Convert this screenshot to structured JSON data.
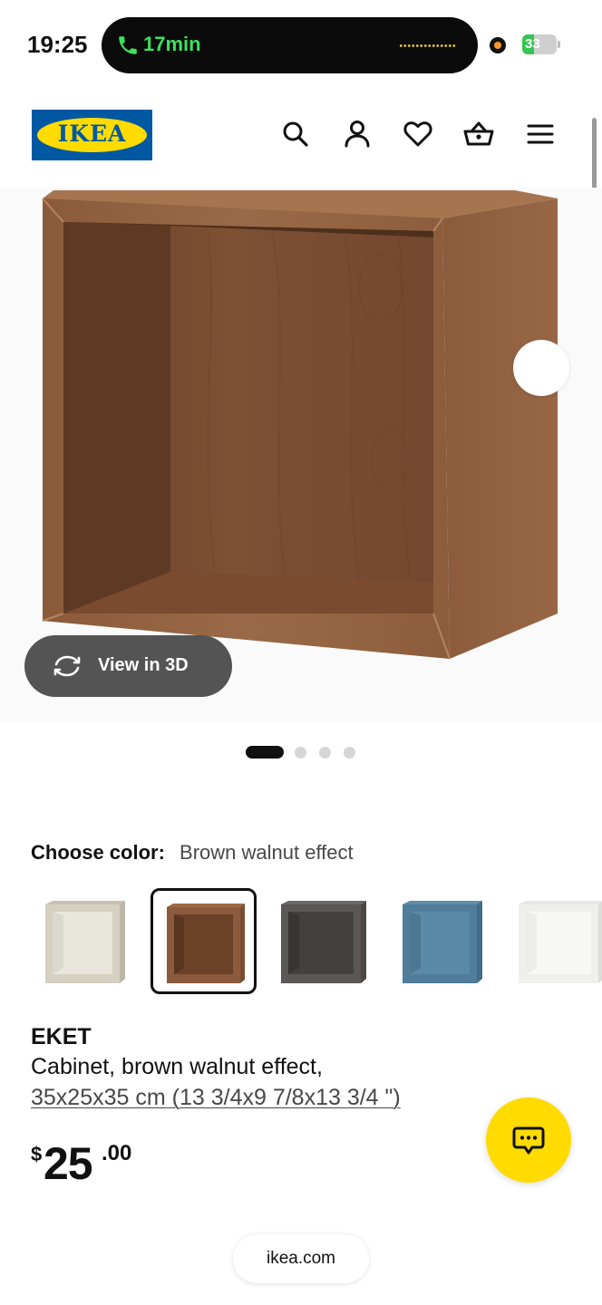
{
  "status_bar": {
    "time": "19:25",
    "call_duration": "17min",
    "battery_level": "33",
    "battery_fraction": 0.33
  },
  "header": {
    "logo_text": "IKEA",
    "icons": [
      "search-icon",
      "account-icon",
      "heart-icon",
      "basket-icon",
      "menu-icon"
    ]
  },
  "gallery": {
    "view_3d_label": "View in 3D",
    "image_count": 4,
    "active_index": 0
  },
  "color_chooser": {
    "label": "Choose color:",
    "selected_value": "Brown walnut effect",
    "swatches": [
      {
        "name": "beige",
        "front": "#d2ccbd",
        "side": "#bdb6a6",
        "inner": "#e8e5dd"
      },
      {
        "name": "brown walnut effect",
        "front": "#8c5a3c",
        "side": "#7a4d32",
        "inner": "#6b4128",
        "selected": true
      },
      {
        "name": "dark gray",
        "front": "#5a5756",
        "side": "#4a4746",
        "inner": "#3f3d3c"
      },
      {
        "name": "blue",
        "front": "#4f7d9a",
        "side": "#426c87",
        "inner": "#5b8aa6"
      },
      {
        "name": "white",
        "front": "#f2f2ef",
        "side": "#e2e2de",
        "inner": "#f7f7f5"
      }
    ]
  },
  "product": {
    "name": "EKET",
    "description": "Cabinet, brown walnut effect,",
    "dimensions": "35x25x35 cm (13 3/4x9 7/8x13 3/4 \")",
    "price_currency": "$",
    "price_integer": "25",
    "price_decimal": ".00"
  },
  "browser": {
    "url": "ikea.com"
  },
  "colors": {
    "brand_blue": "#0058a3",
    "brand_yellow": "#ffdb00",
    "call_green": "#3ee05a"
  }
}
